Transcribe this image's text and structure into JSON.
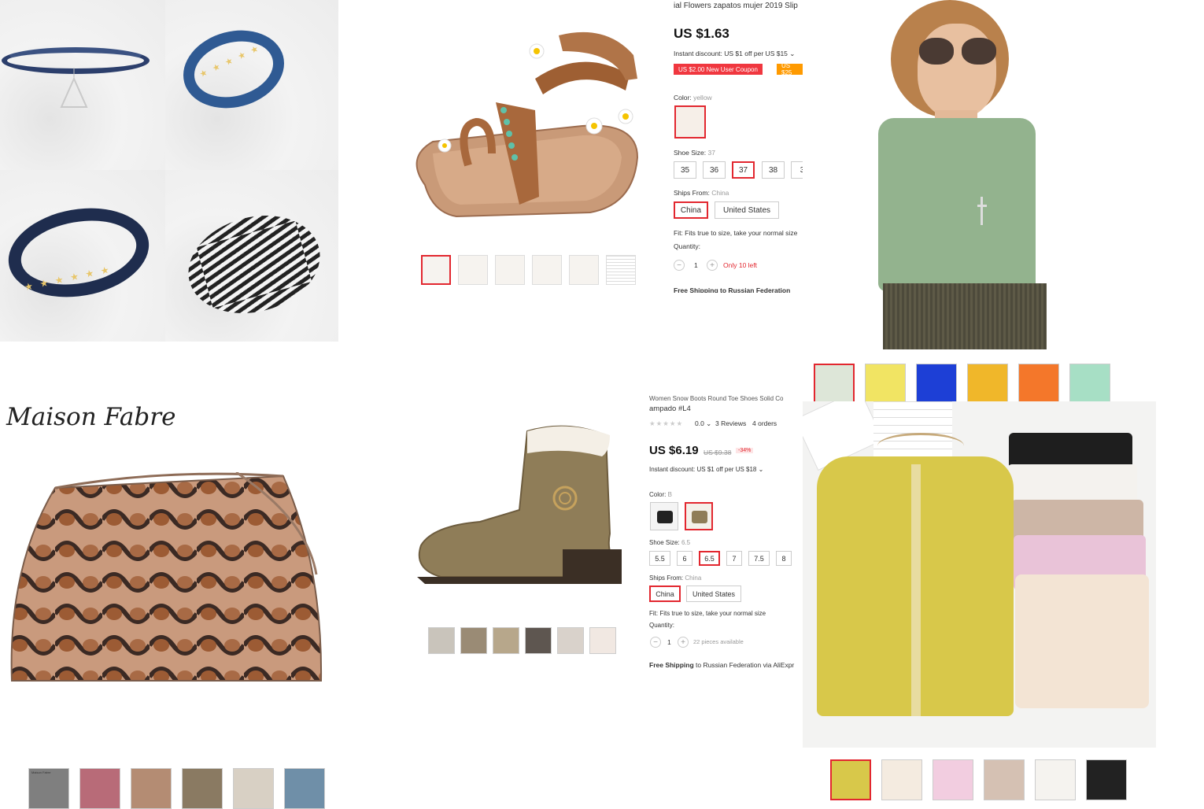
{
  "sandal": {
    "title": "ial Flowers zapatos mujer 2019 Slip",
    "price": "US $1.63",
    "instant_discount": "Instant discount: US $1 off per US $15 ⌄",
    "coupon_new_user": "US $2.00 New User Coupon",
    "coupon_other": "US $25",
    "color_label": "Color:",
    "color_value": "yellow",
    "size_label": "Shoe Size:",
    "size_value": "37",
    "sizes": [
      "35",
      "36",
      "37",
      "38",
      "3"
    ],
    "ships_label": "Ships From:",
    "ships_value": "China",
    "ships_options": [
      "China",
      "United States"
    ],
    "fit_note": "Fit: Fits true to size, take your normal size",
    "quantity_label": "Quantity:",
    "quantity_value": "1",
    "stock_note": "Only 10 left",
    "shipping_cut": "Free Shipping to Russian Federation"
  },
  "boot": {
    "title_line1": "Women Snow Boots Round Toe Shoes Solid Co",
    "title_line2": "ampado #L4",
    "rating": "0.0 ⌄",
    "reviews": "3 Reviews",
    "orders": "4 orders",
    "price": "US $6.19",
    "old_price": "US $9.38",
    "discount": "-34%",
    "instant_discount": "Instant discount: US $1 off per US $18 ⌄",
    "color_label": "Color:",
    "color_value": "B",
    "size_label": "Shoe Size:",
    "size_value": "6.5",
    "sizes": [
      "5.5",
      "6",
      "6.5",
      "7",
      "7.5",
      "8"
    ],
    "ships_label": "Ships From:",
    "ships_value": "China",
    "ships_options": [
      "China",
      "United States"
    ],
    "fit_note": "Fit: Fits true to size, take your normal size",
    "quantity_label": "Quantity:",
    "quantity_value": "1",
    "stock_note": "22 pieces available",
    "shipping_bold": "Free Shipping",
    "shipping_rest": "to Russian Federation via AliExpr"
  },
  "bag": {
    "brand": "Maison Fabre",
    "thumb_brand": "Maison Fabre"
  },
  "colors": {
    "accent_red": "#e2272f",
    "coupon_red": "#f0373f",
    "coupon_orange": "#ff9a00",
    "cardigan_yellow": "#d8c84a"
  }
}
